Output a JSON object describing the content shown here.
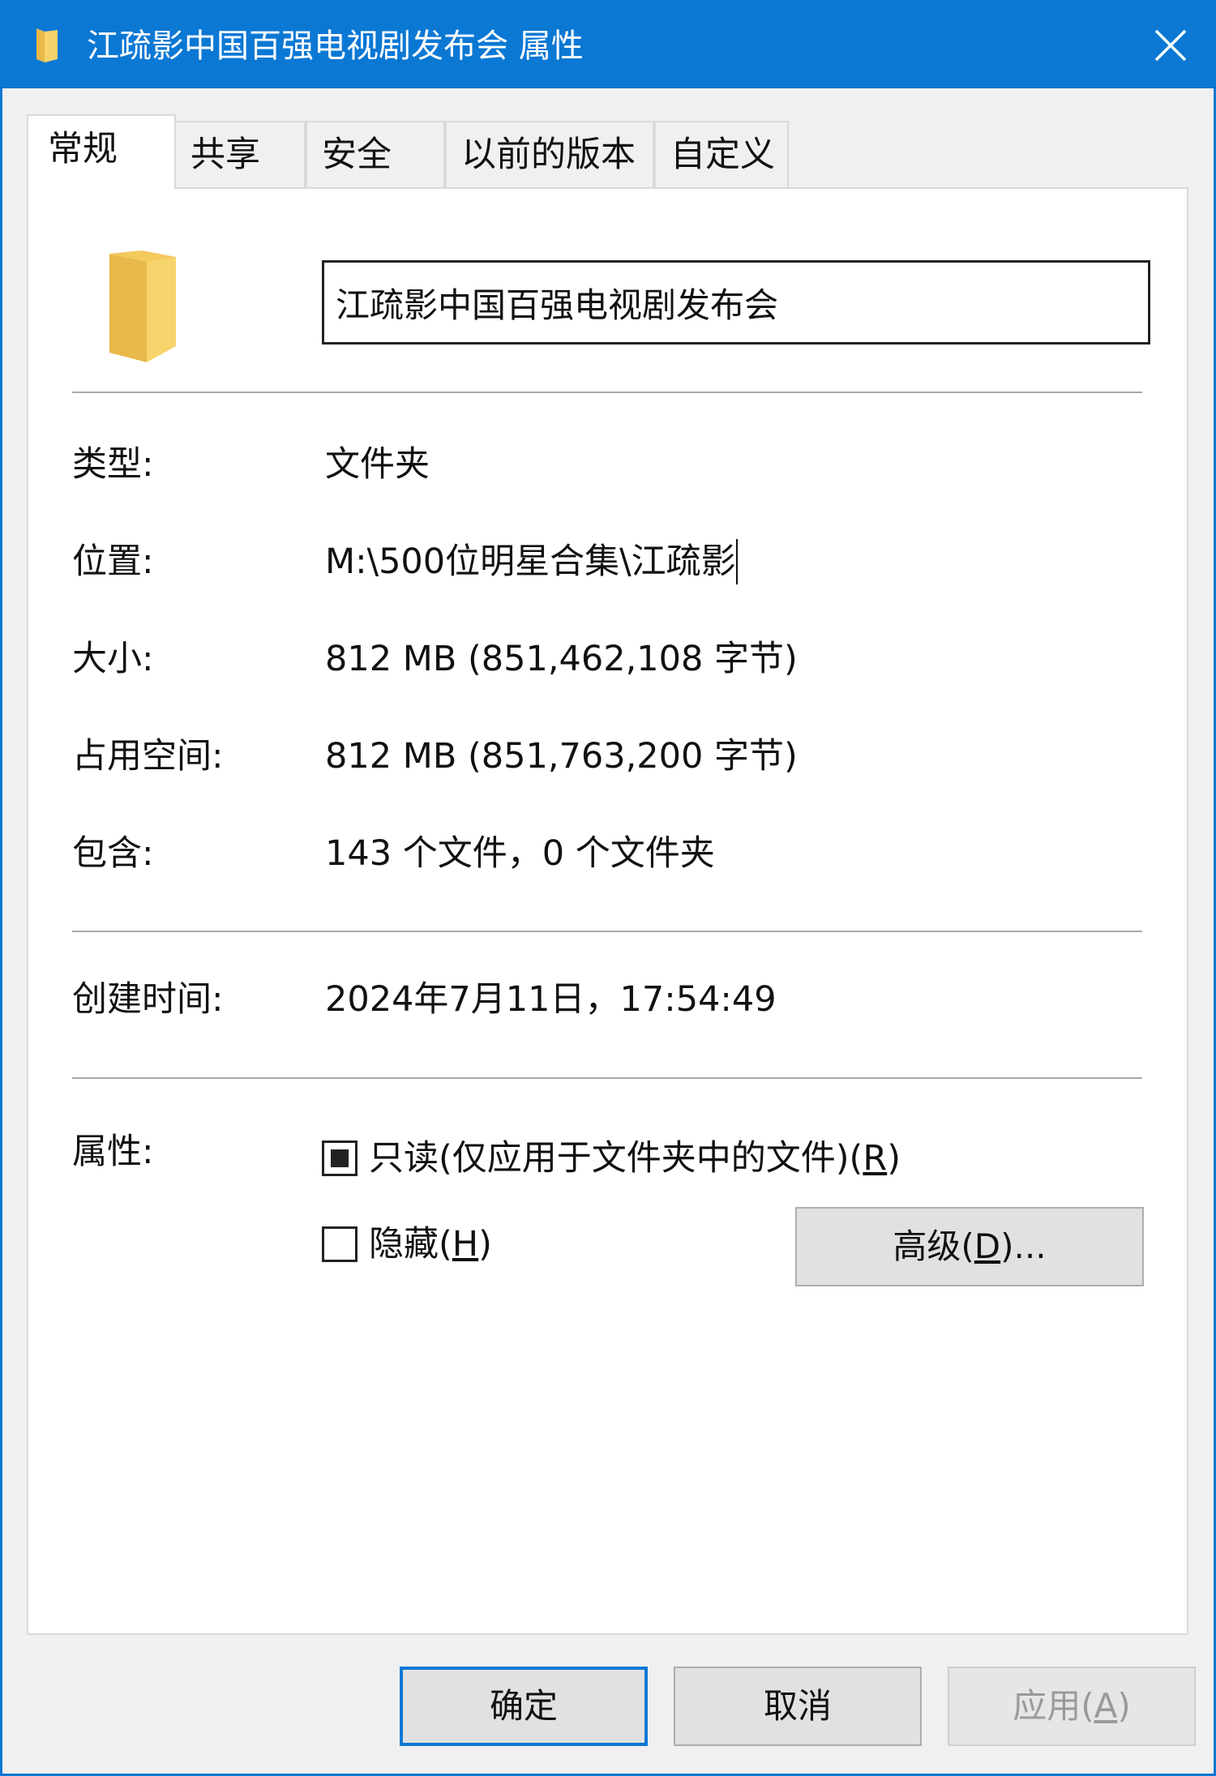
{
  "window": {
    "title": "江疏影中国百强电视剧发布会 属性",
    "accent": "#0b78d4"
  },
  "tabs": [
    {
      "label": "常规",
      "active": true
    },
    {
      "label": "共享",
      "active": false
    },
    {
      "label": "安全",
      "active": false
    },
    {
      "label": "以前的版本",
      "active": false
    },
    {
      "label": "自定义",
      "active": false
    }
  ],
  "general": {
    "name_value": "江疏影中国百强电视剧发布会",
    "type_label": "类型:",
    "type_value": "文件夹",
    "location_label": "位置:",
    "location_value": "M:\\500位明星合集\\江疏影",
    "size_label": "大小:",
    "size_value": "812 MB (851,462,108 字节)",
    "disk_label": "占用空间:",
    "disk_value": "812 MB (851,763,200 字节)",
    "contains_label": "包含:",
    "contains_value": "143 个文件，0 个文件夹",
    "created_label": "创建时间:",
    "created_value": "2024年7月11日，17:54:49",
    "attributes_label": "属性:",
    "readonly_text": "只读(仅应用于文件夹中的文件)(",
    "readonly_key": "R",
    "readonly_state": "indeterminate",
    "hidden_text": "隐藏(",
    "hidden_key": "H",
    "hidden_checked": false,
    "advanced_text": "高级(",
    "advanced_key": "D",
    "advanced_suffix": ")..."
  },
  "footer": {
    "ok_label": "确定",
    "cancel_label": "取消",
    "apply_text": "应用(",
    "apply_key": "A",
    "apply_enabled": false
  }
}
